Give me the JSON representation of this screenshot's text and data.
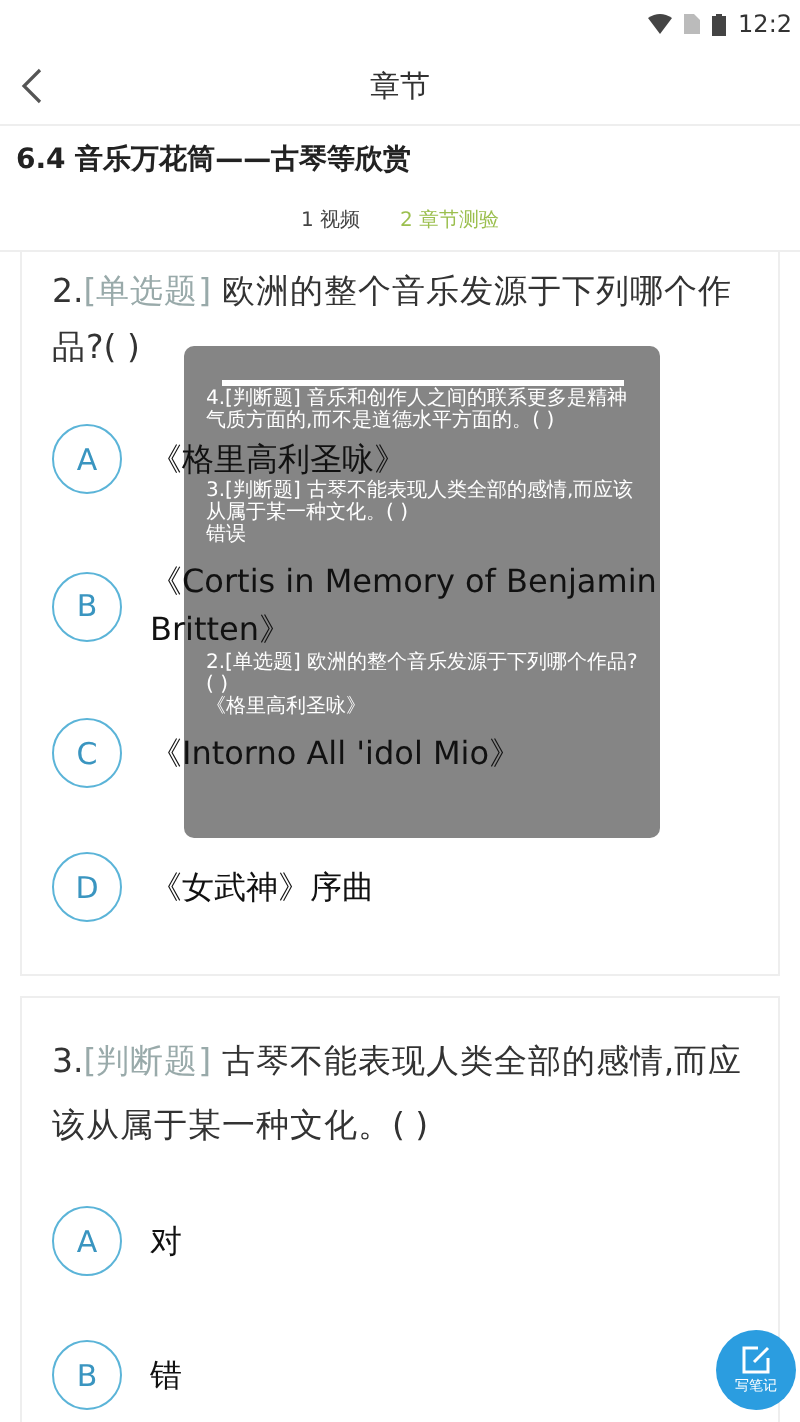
{
  "status_bar": {
    "time": "12:2"
  },
  "header": {
    "title": "章节"
  },
  "section": {
    "title": "6.4 音乐万花筒——古琴等欣赏"
  },
  "tabs": [
    {
      "label": "1 视频",
      "selected": false
    },
    {
      "label": "2 章节测验",
      "selected": true
    }
  ],
  "questions": [
    {
      "number": "2.",
      "type": "[单选题]",
      "text": " 欧洲的整个音乐发源于下列哪个作品?( )",
      "options": [
        {
          "letter": "A",
          "text": "《格里高利圣咏》"
        },
        {
          "letter": "B",
          "text": "《Cortis in Memory of Benjamin Britten》"
        },
        {
          "letter": "C",
          "text": "《Intorno All 'idol Mio》"
        },
        {
          "letter": "D",
          "text": "《女武神》序曲"
        }
      ]
    },
    {
      "number": "3.",
      "type": "[判断题]",
      "text": " 古琴不能表现人类全部的感情,而应该从属于某一种文化。( )",
      "options": [
        {
          "letter": "A",
          "text": "对"
        },
        {
          "letter": "B",
          "text": "错"
        }
      ]
    }
  ],
  "overlay": {
    "items": [
      {
        "question": "4.[判断题] 音乐和创作人之间的联系更多是精神气质方面的,而不是道德水平方面的。( )"
      },
      {
        "question": "3.[判断题] 古琴不能表现人类全部的感情,而应该从属于某一种文化。( )",
        "answer": "错误"
      },
      {
        "question": "2.[单选题] 欧洲的整个音乐发源于下列哪个作品?( )",
        "answer": "《格里高利圣咏》"
      }
    ]
  },
  "fab": {
    "label": "写笔记"
  }
}
